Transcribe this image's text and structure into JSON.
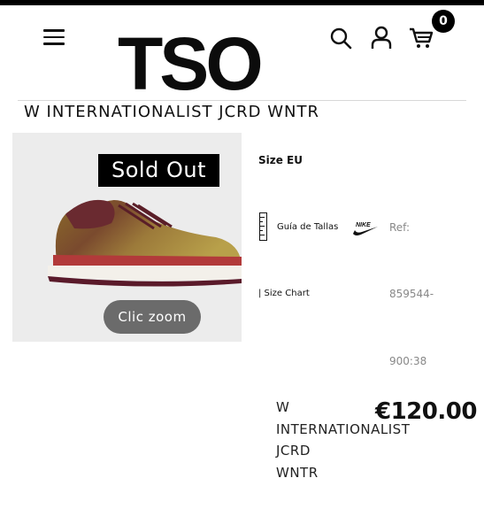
{
  "header": {
    "logo_text": "TSO",
    "cart_count": "0",
    "icons": [
      "menu-icon",
      "search-icon",
      "account-icon",
      "cart-icon"
    ]
  },
  "product": {
    "title": "W INTERNATIONALIST JCRD WNTR",
    "sold_out_label": "Sold Out",
    "zoom_label": "Clic zoom",
    "size_label": "Size EU",
    "size_guide_label": "Guía de Tallas",
    "size_chart_label": "| Size Chart",
    "ref_label": "Ref:",
    "ref_line1": "859544-",
    "ref_line2": "900:38",
    "name_lines": [
      "W",
      "INTERNATIONALIST",
      "JCRD",
      "WNTR"
    ],
    "price": "€120.00",
    "brand_logo": "nike-swoosh"
  },
  "colors": {
    "badge": "#000000",
    "zoom_button": "#6b6b6b",
    "muted_text": "#888888"
  }
}
